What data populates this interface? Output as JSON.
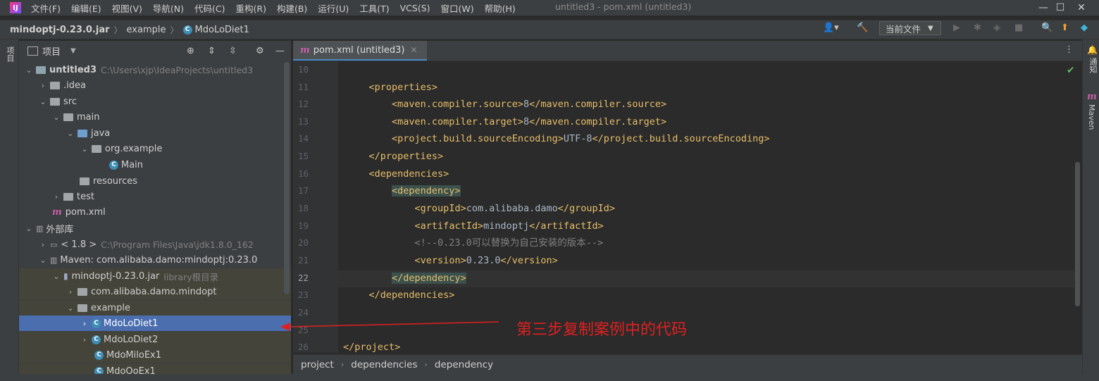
{
  "menubar": {
    "items": [
      "文件(F)",
      "编辑(E)",
      "视图(V)",
      "导航(N)",
      "代码(C)",
      "重构(R)",
      "构建(B)",
      "运行(U)",
      "工具(T)",
      "VCS(S)",
      "窗口(W)",
      "帮助(H)"
    ],
    "window_title": "untitled3 - pom.xml (untitled3)",
    "minimize": "—",
    "maximize": "☐",
    "close": "✕"
  },
  "navbar": {
    "crumbs": [
      "mindoptj-0.23.0.jar",
      "example",
      "MdoLoDiet1"
    ],
    "run_config": "当前文件"
  },
  "project": {
    "header_label": "项目",
    "rows": [
      {
        "label": "untitled3",
        "hint": "C:\\Users\\xjp\\IdeaProjects\\untitled3"
      },
      {
        "label": ".idea"
      },
      {
        "label": "src"
      },
      {
        "label": "main"
      },
      {
        "label": "java"
      },
      {
        "label": "org.example"
      },
      {
        "label": "Main"
      },
      {
        "label": "resources"
      },
      {
        "label": "test"
      },
      {
        "label": "pom.xml"
      },
      {
        "label": "外部库"
      },
      {
        "label": "< 1.8 >",
        "hint": "C:\\Program Files\\Java\\jdk1.8.0_162"
      },
      {
        "label": "Maven: com.alibaba.damo:mindoptj:0.23.0"
      },
      {
        "label": "mindoptj-0.23.0.jar",
        "hint": "library根目录"
      },
      {
        "label": "com.alibaba.damo.mindopt"
      },
      {
        "label": "example"
      },
      {
        "label": "MdoLoDiet1"
      },
      {
        "label": "MdoLoDiet2"
      },
      {
        "label": "MdoMiloEx1"
      },
      {
        "label": "MdoQoEx1"
      }
    ]
  },
  "left_strip_label": "项目",
  "right_strip": {
    "notifications": "通知",
    "maven": "Maven"
  },
  "editor": {
    "tab_label": "pom.xml (untitled3)",
    "lines": [
      {
        "n": "10",
        "code": ""
      },
      {
        "n": "11",
        "code": "    <properties>"
      },
      {
        "n": "12",
        "code": "        <maven.compiler.source>8</maven.compiler.source>"
      },
      {
        "n": "13",
        "code": "        <maven.compiler.target>8</maven.compiler.target>"
      },
      {
        "n": "14",
        "code": "        <project.build.sourceEncoding>UTF-8</project.build.sourceEncoding>"
      },
      {
        "n": "15",
        "code": "    </properties>"
      },
      {
        "n": "16",
        "code": "    <dependencies>"
      },
      {
        "n": "17",
        "code": "        <dependency>"
      },
      {
        "n": "18",
        "code": "            <groupId>com.alibaba.damo</groupId>"
      },
      {
        "n": "19",
        "code": "            <artifactId>mindoptj</artifactId>"
      },
      {
        "n": "20",
        "code": "            <!--0.23.0可以替换为自己安装的版本-->"
      },
      {
        "n": "21",
        "code": "            <version>0.23.0</version>"
      },
      {
        "n": "22",
        "code": "        </dependency>"
      },
      {
        "n": "23",
        "code": "    </dependencies>"
      },
      {
        "n": "24",
        "code": ""
      },
      {
        "n": "25",
        "code": ""
      },
      {
        "n": "26",
        "code": "</project>"
      }
    ],
    "breadcrumbs": [
      "project",
      "dependencies",
      "dependency"
    ]
  },
  "annotation": {
    "text": "第三步复制案例中的代码",
    "color": "#e02020"
  },
  "colors": {
    "selection": "#4b6eaf",
    "library_bg": "#45443a",
    "xml_tag": "#e8bf6a"
  }
}
